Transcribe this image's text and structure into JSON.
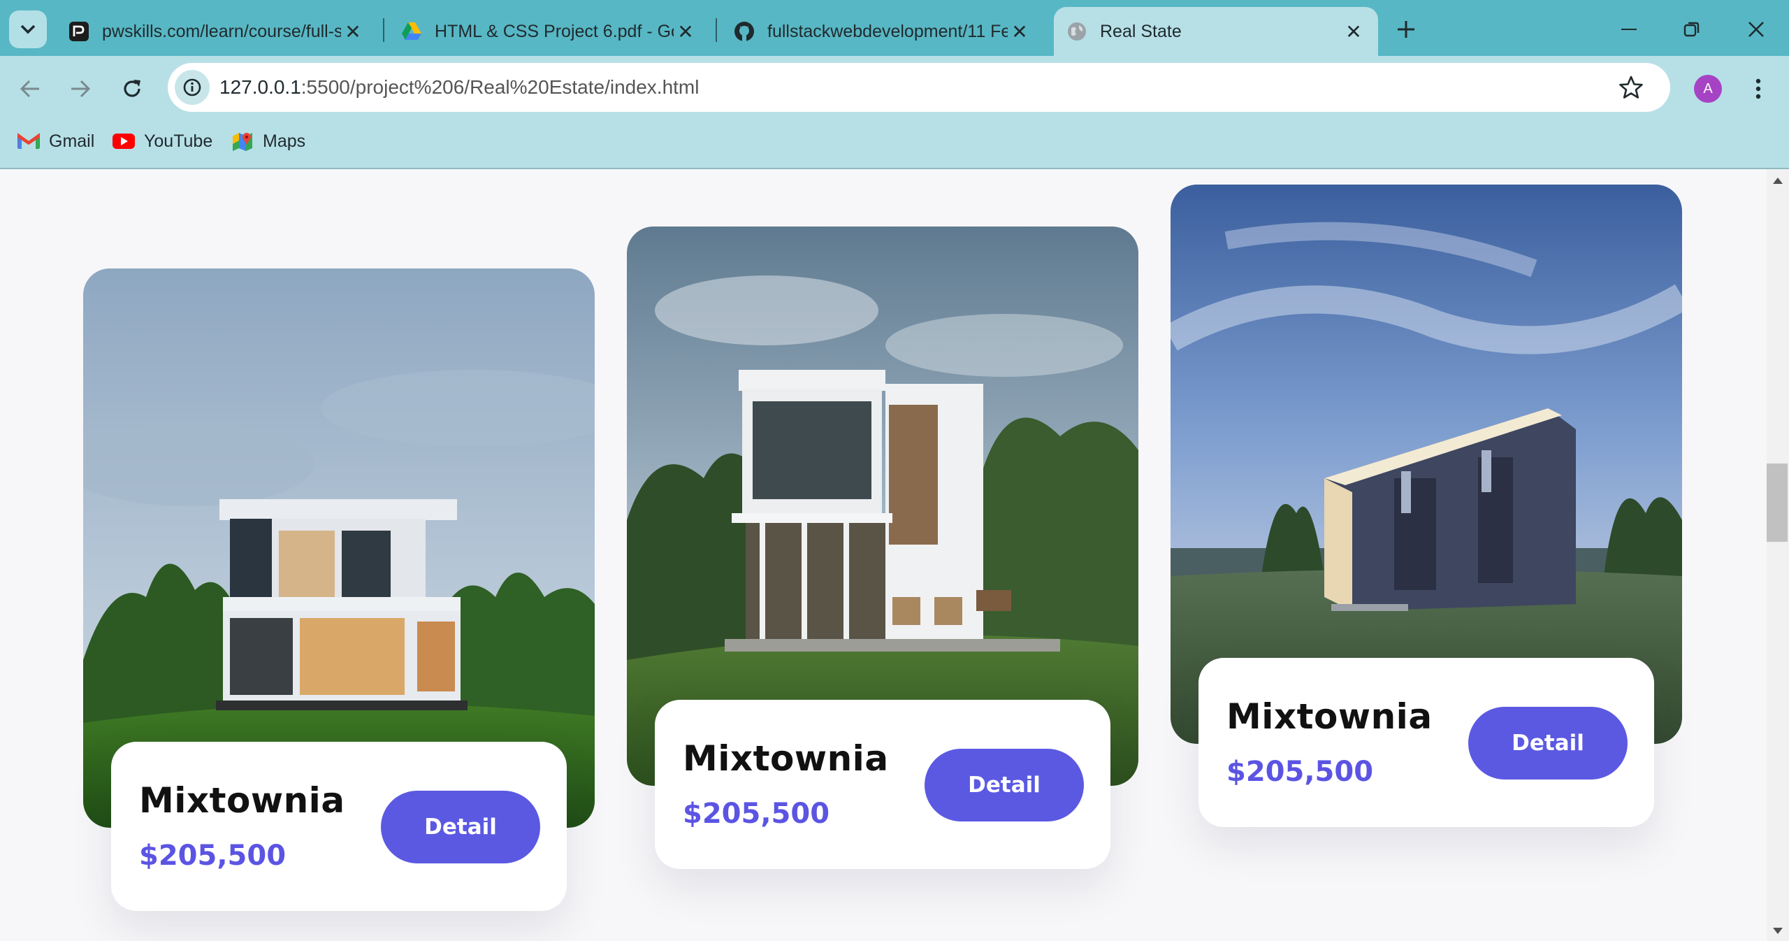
{
  "browser": {
    "tabs": [
      {
        "title": "pwskills.com/learn/course/full-s",
        "favicon": "pwskills-icon",
        "active": false
      },
      {
        "title": "HTML & CSS Project 6.pdf - Goo",
        "favicon": "google-drive-icon",
        "active": false
      },
      {
        "title": "fullstackwebdevelopment/11 Fe",
        "favicon": "github-icon",
        "active": false
      },
      {
        "title": "Real State",
        "favicon": "globe-icon",
        "active": true
      }
    ],
    "url_host": "127.0.0.1",
    "url_rest": ":5500/project%206/Real%20Estate/index.html",
    "avatar_letter": "A",
    "bookmarks": [
      {
        "label": "Gmail",
        "icon": "gmail-icon"
      },
      {
        "label": "YouTube",
        "icon": "youtube-icon"
      },
      {
        "label": "Maps",
        "icon": "maps-icon"
      }
    ]
  },
  "page": {
    "cards": [
      {
        "name": "Mixtownia",
        "price": "$205,500",
        "button": "Detail"
      },
      {
        "name": "Mixtownia",
        "price": "$205,500",
        "button": "Detail"
      },
      {
        "name": "Mixtownia",
        "price": "$205,500",
        "button": "Detail"
      }
    ],
    "scroll_fraction": 0.42
  },
  "colors": {
    "tabstrip": "#58b7c4",
    "toolbar": "#b7e0e6",
    "accent": "#5b59e2",
    "price": "#5b54e3"
  }
}
